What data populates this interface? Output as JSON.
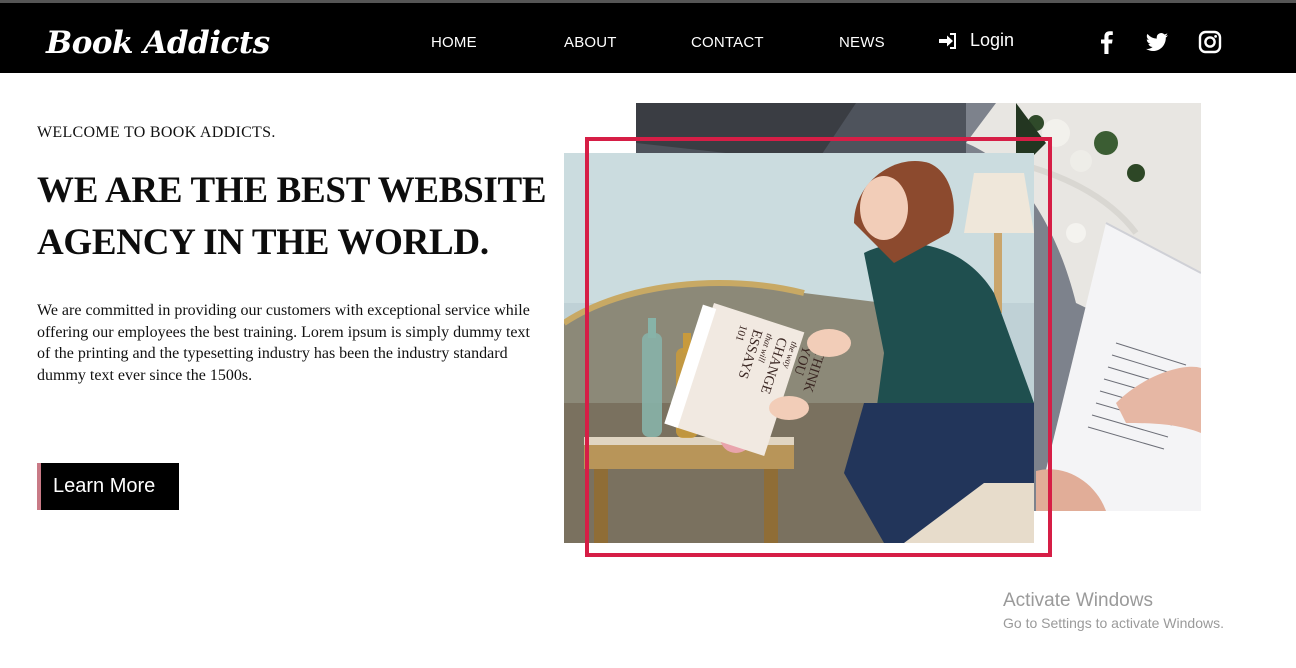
{
  "brand": {
    "logo_text": "Book Addicts"
  },
  "nav": {
    "items": [
      {
        "label": "HOME"
      },
      {
        "label": "ABOUT"
      },
      {
        "label": "CONTACT"
      },
      {
        "label": "NEWS"
      }
    ],
    "login_label": "Login",
    "login_icon": "sign-in-icon",
    "social_icons": [
      "facebook-icon",
      "twitter-icon",
      "instagram-icon"
    ]
  },
  "hero": {
    "welcome": "WELCOME TO BOOK ADDICTS.",
    "headline": "WE ARE THE BEST WEBSITE AGENCY IN THE WORLD.",
    "body": "We are committed in providing our customers with exceptional service while offering our employees the best training. Lorem ipsum is simply dummy text of the printing and the typesetting industry has been the industry standard dummy text ever since the 1500s.",
    "cta_label": "Learn More"
  },
  "image_book_cover": {
    "line1": "101",
    "line2": "ESSAYS",
    "line3": "that will",
    "line4": "CHANGE",
    "line5": "the way",
    "line6": "YOU",
    "line7": "THINK"
  },
  "colors": {
    "navbar": "#000000",
    "frame_accent": "#d61e46",
    "cta_accent": "#c97a86"
  },
  "os_watermark": {
    "title": "Activate Windows",
    "subtitle": "Go to Settings to activate Windows."
  }
}
